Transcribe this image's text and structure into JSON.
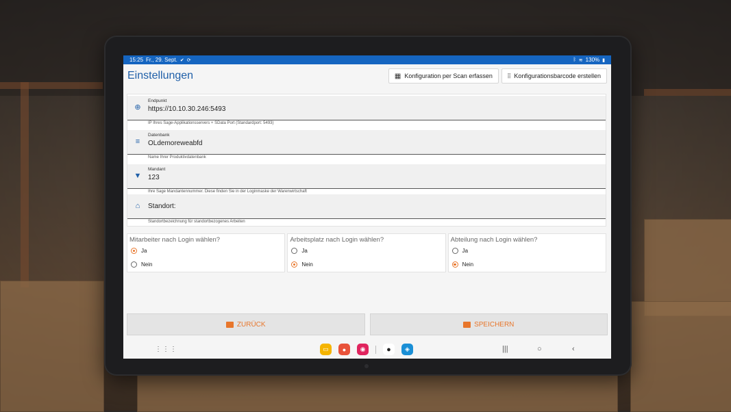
{
  "statusbar": {
    "time": "15:25",
    "date": "Fr., 29. Sept.",
    "battery": "130%"
  },
  "header": {
    "title": "Einstellungen",
    "scan_button": "Konfiguration per Scan erfassen",
    "barcode_button": "Konfigurationsbarcode erstellen"
  },
  "fields": [
    {
      "icon": "globe-icon",
      "label": "Endpunkt",
      "value": "https://10.10.30.246:5493",
      "hint": "IP Ihres Sage-Applikationsservers + SData Port (Standardport: 5493)"
    },
    {
      "icon": "database-icon",
      "label": "Datenbank",
      "value": "OLdemoreweabfd",
      "hint": "Name Ihrer Produktivdatenbank"
    },
    {
      "icon": "bookmark-icon",
      "label": "Mandant",
      "value": "123",
      "hint": "Ihre Sage Mandantennummer. Diese finden Sie in der Loginmaske der Warenwirtschaft"
    },
    {
      "icon": "warehouse-icon",
      "label": "Standort:",
      "value": "",
      "hint": "Standortbezeichnung für standortbezogenes Arbeiten"
    }
  ],
  "radio_groups": [
    {
      "title": "Mitarbeiter nach Login wählen?",
      "options": [
        "Ja",
        "Nein"
      ],
      "selected": "Ja"
    },
    {
      "title": "Arbeitsplatz nach Login wählen?",
      "options": [
        "Ja",
        "Nein"
      ],
      "selected": "Nein"
    },
    {
      "title": "Abteilung nach Login wählen?",
      "options": [
        "Ja",
        "Nein"
      ],
      "selected": "Nein"
    }
  ],
  "actions": {
    "back": "ZURÜCK",
    "save": "SPEICHERN"
  },
  "colors": {
    "accent": "#e8762b",
    "title": "#1f5fa8",
    "statusbar": "#1565c0"
  }
}
